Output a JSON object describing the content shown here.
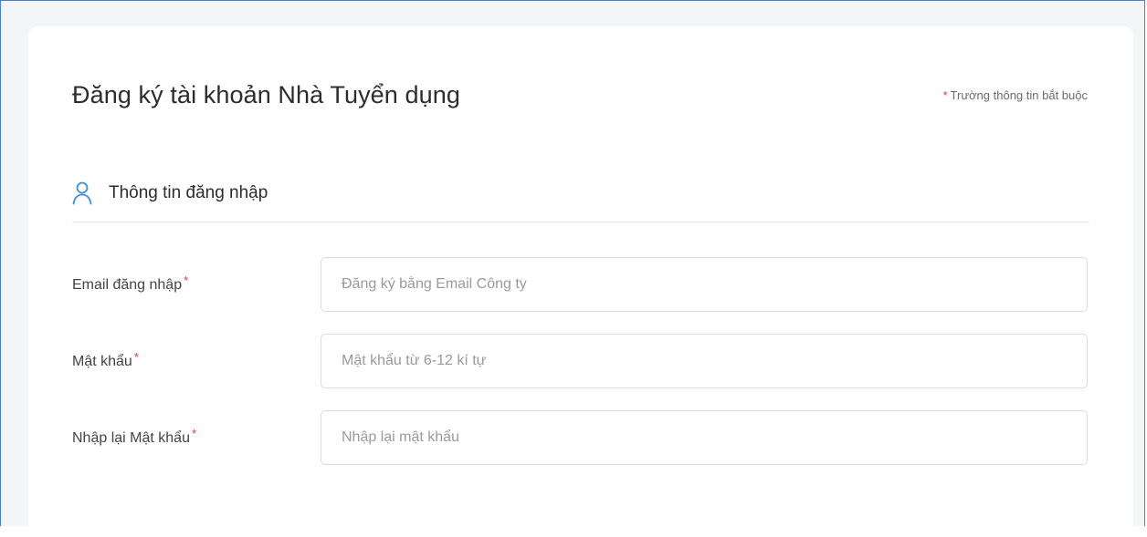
{
  "header": {
    "title": "Đăng ký tài khoản Nhà Tuyển dụng",
    "required_star": "*",
    "required_note": "Trường thông tin bắt buộc"
  },
  "section": {
    "icon": "user-icon",
    "title": "Thông tin đăng nhập"
  },
  "colors": {
    "accent": "#3d8fe0",
    "required": "#e53935",
    "frame_border": "#4a7fd0"
  },
  "form": {
    "fields": [
      {
        "label": "Email đăng nhập",
        "required": "*",
        "value": "",
        "placeholder": "Đăng ký bằng Email Công ty"
      },
      {
        "label": "Mật khẩu",
        "required": "*",
        "value": "",
        "placeholder": "Mật khẩu từ 6-12 kí tự"
      },
      {
        "label": "Nhập lại Mật khẩu",
        "required": "*",
        "value": "",
        "placeholder": "Nhập lại mật khẩu"
      }
    ]
  }
}
